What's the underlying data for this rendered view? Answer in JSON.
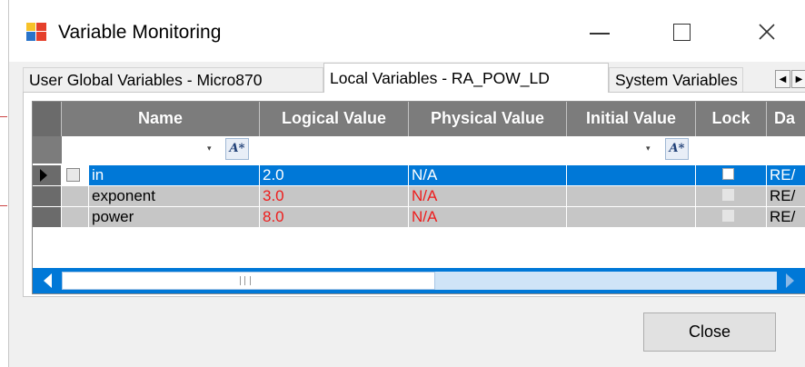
{
  "window": {
    "title": "Variable Monitoring"
  },
  "title_controls": {
    "minimize_icon": "minimize-icon",
    "maximize_icon": "maximize-icon",
    "close_icon": "close-icon",
    "close_glyph": "✕"
  },
  "tabs": [
    {
      "label": "User Global Variables - Micro870",
      "active": false
    },
    {
      "label": "Local Variables - RA_POW_LD",
      "active": true
    },
    {
      "label": "System Variables",
      "active": false
    }
  ],
  "tab_scroll": {
    "left": "◀",
    "right": "▶"
  },
  "grid": {
    "columns": [
      "Name",
      "Logical Value",
      "Physical Value",
      "Initial Value",
      "Lock",
      "Da"
    ],
    "filter": {
      "dropdown_glyph": "▾",
      "button_glyph": "A*"
    },
    "rows": [
      {
        "name": "in",
        "logical": "2.0",
        "physical": "N/A",
        "initial": "",
        "type": "RE/",
        "selected": true
      },
      {
        "name": "exponent",
        "logical": "3.0",
        "physical": "N/A",
        "initial": "",
        "type": "RE/",
        "selected": false
      },
      {
        "name": "power",
        "logical": "8.0",
        "physical": "N/A",
        "initial": "",
        "type": "RE/",
        "selected": false
      }
    ]
  },
  "footer": {
    "close_label": "Close"
  },
  "colors": {
    "selection": "#0078d7",
    "header": "#7c7c7c",
    "value_red": "#ee1c1c"
  }
}
